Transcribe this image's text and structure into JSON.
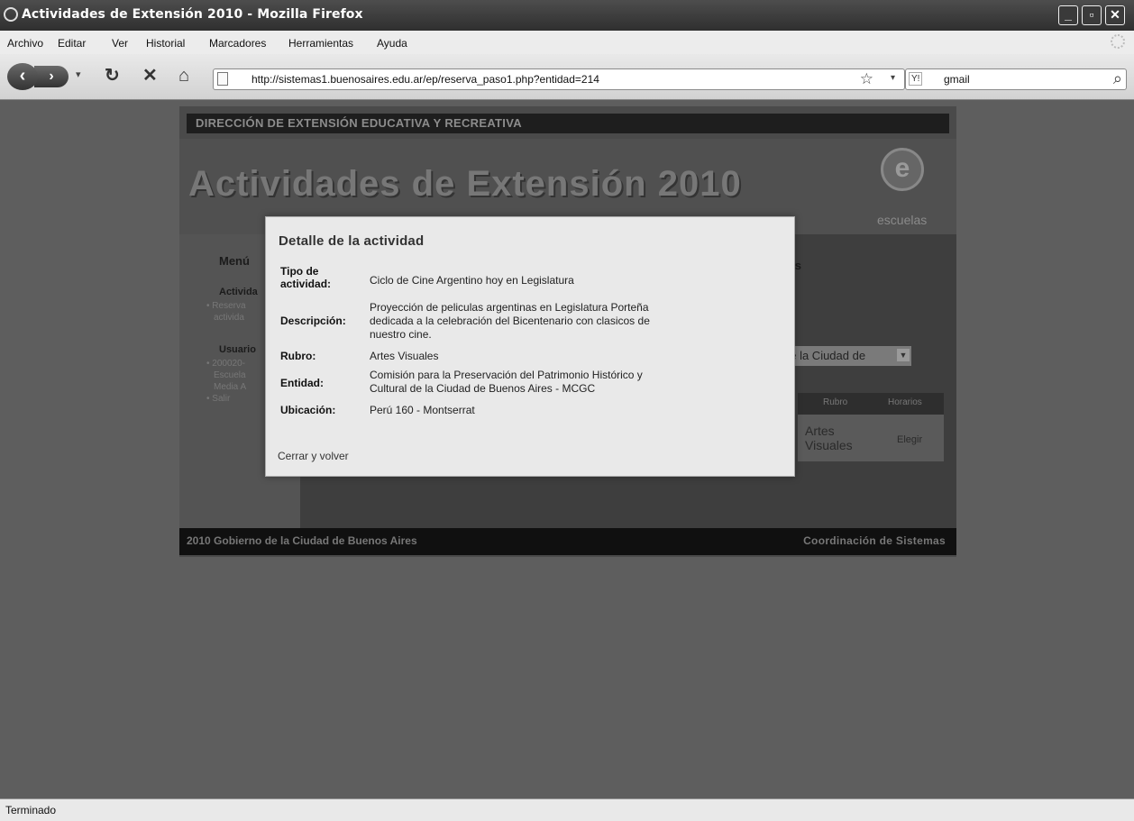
{
  "window": {
    "title": "Actividades de Extensión 2010 - Mozilla Firefox",
    "controls": [
      "_",
      "▫",
      "✕"
    ]
  },
  "menubar": {
    "items": [
      "Archivo",
      "Editar",
      "Ver",
      "Historial",
      "Marcadores",
      "Herramientas",
      "Ayuda"
    ]
  },
  "navbar": {
    "url": "http://sistemas1.buenosaires.edu.ar/ep/reserva_paso1.php?entidad=214",
    "search_query": "gmail",
    "search_engine": "Y!"
  },
  "site": {
    "top_strip": "DIRECCIÓN DE EXTENSIÓN EDUCATIVA Y RECREATIVA",
    "banner_title": "Actividades de Extensión 2010",
    "logo_letter": "e",
    "logo_text": "escuelas",
    "sidebar": {
      "menu_heading": "Menú",
      "section1": "Activida",
      "section1_items": [
        "Reserva",
        "activida"
      ],
      "section2": "Usuario",
      "section2_items": [
        "200020-",
        "Escuela",
        "Media A",
        "Salir"
      ]
    },
    "main": {
      "heading_fragment": "ides",
      "select_value": "de la Ciudad de",
      "table_headers": [
        "Rubro",
        "Horarios"
      ],
      "row": {
        "rubro": "Artes Visuales",
        "action": "Elegir"
      }
    },
    "footer_left": "2010 Gobierno de la Ciudad de Buenos Aires",
    "footer_right": "Coordinación de Sistemas"
  },
  "modal": {
    "title": "Detalle de la actividad",
    "fields": [
      {
        "label": "Tipo de actividad:",
        "value": "Ciclo de Cine Argentino hoy en Legislatura"
      },
      {
        "label": "Descripción:",
        "value": "Proyección de peliculas argentinas en Legislatura Porteña dedicada a la celebración del Bicentenario con clasicos de nuestro cine."
      },
      {
        "label": "Rubro:",
        "value": "Artes Visuales"
      },
      {
        "label": "Entidad:",
        "value": "Comisión para la Preservación del Patrimonio Histórico y Cultural de la Ciudad de Buenos Aires - MCGC"
      },
      {
        "label": "Ubicación:",
        "value": "Perú 160 - Montserrat"
      }
    ],
    "close_link": "Cerrar y volver"
  },
  "statusbar": {
    "text": "Terminado"
  }
}
